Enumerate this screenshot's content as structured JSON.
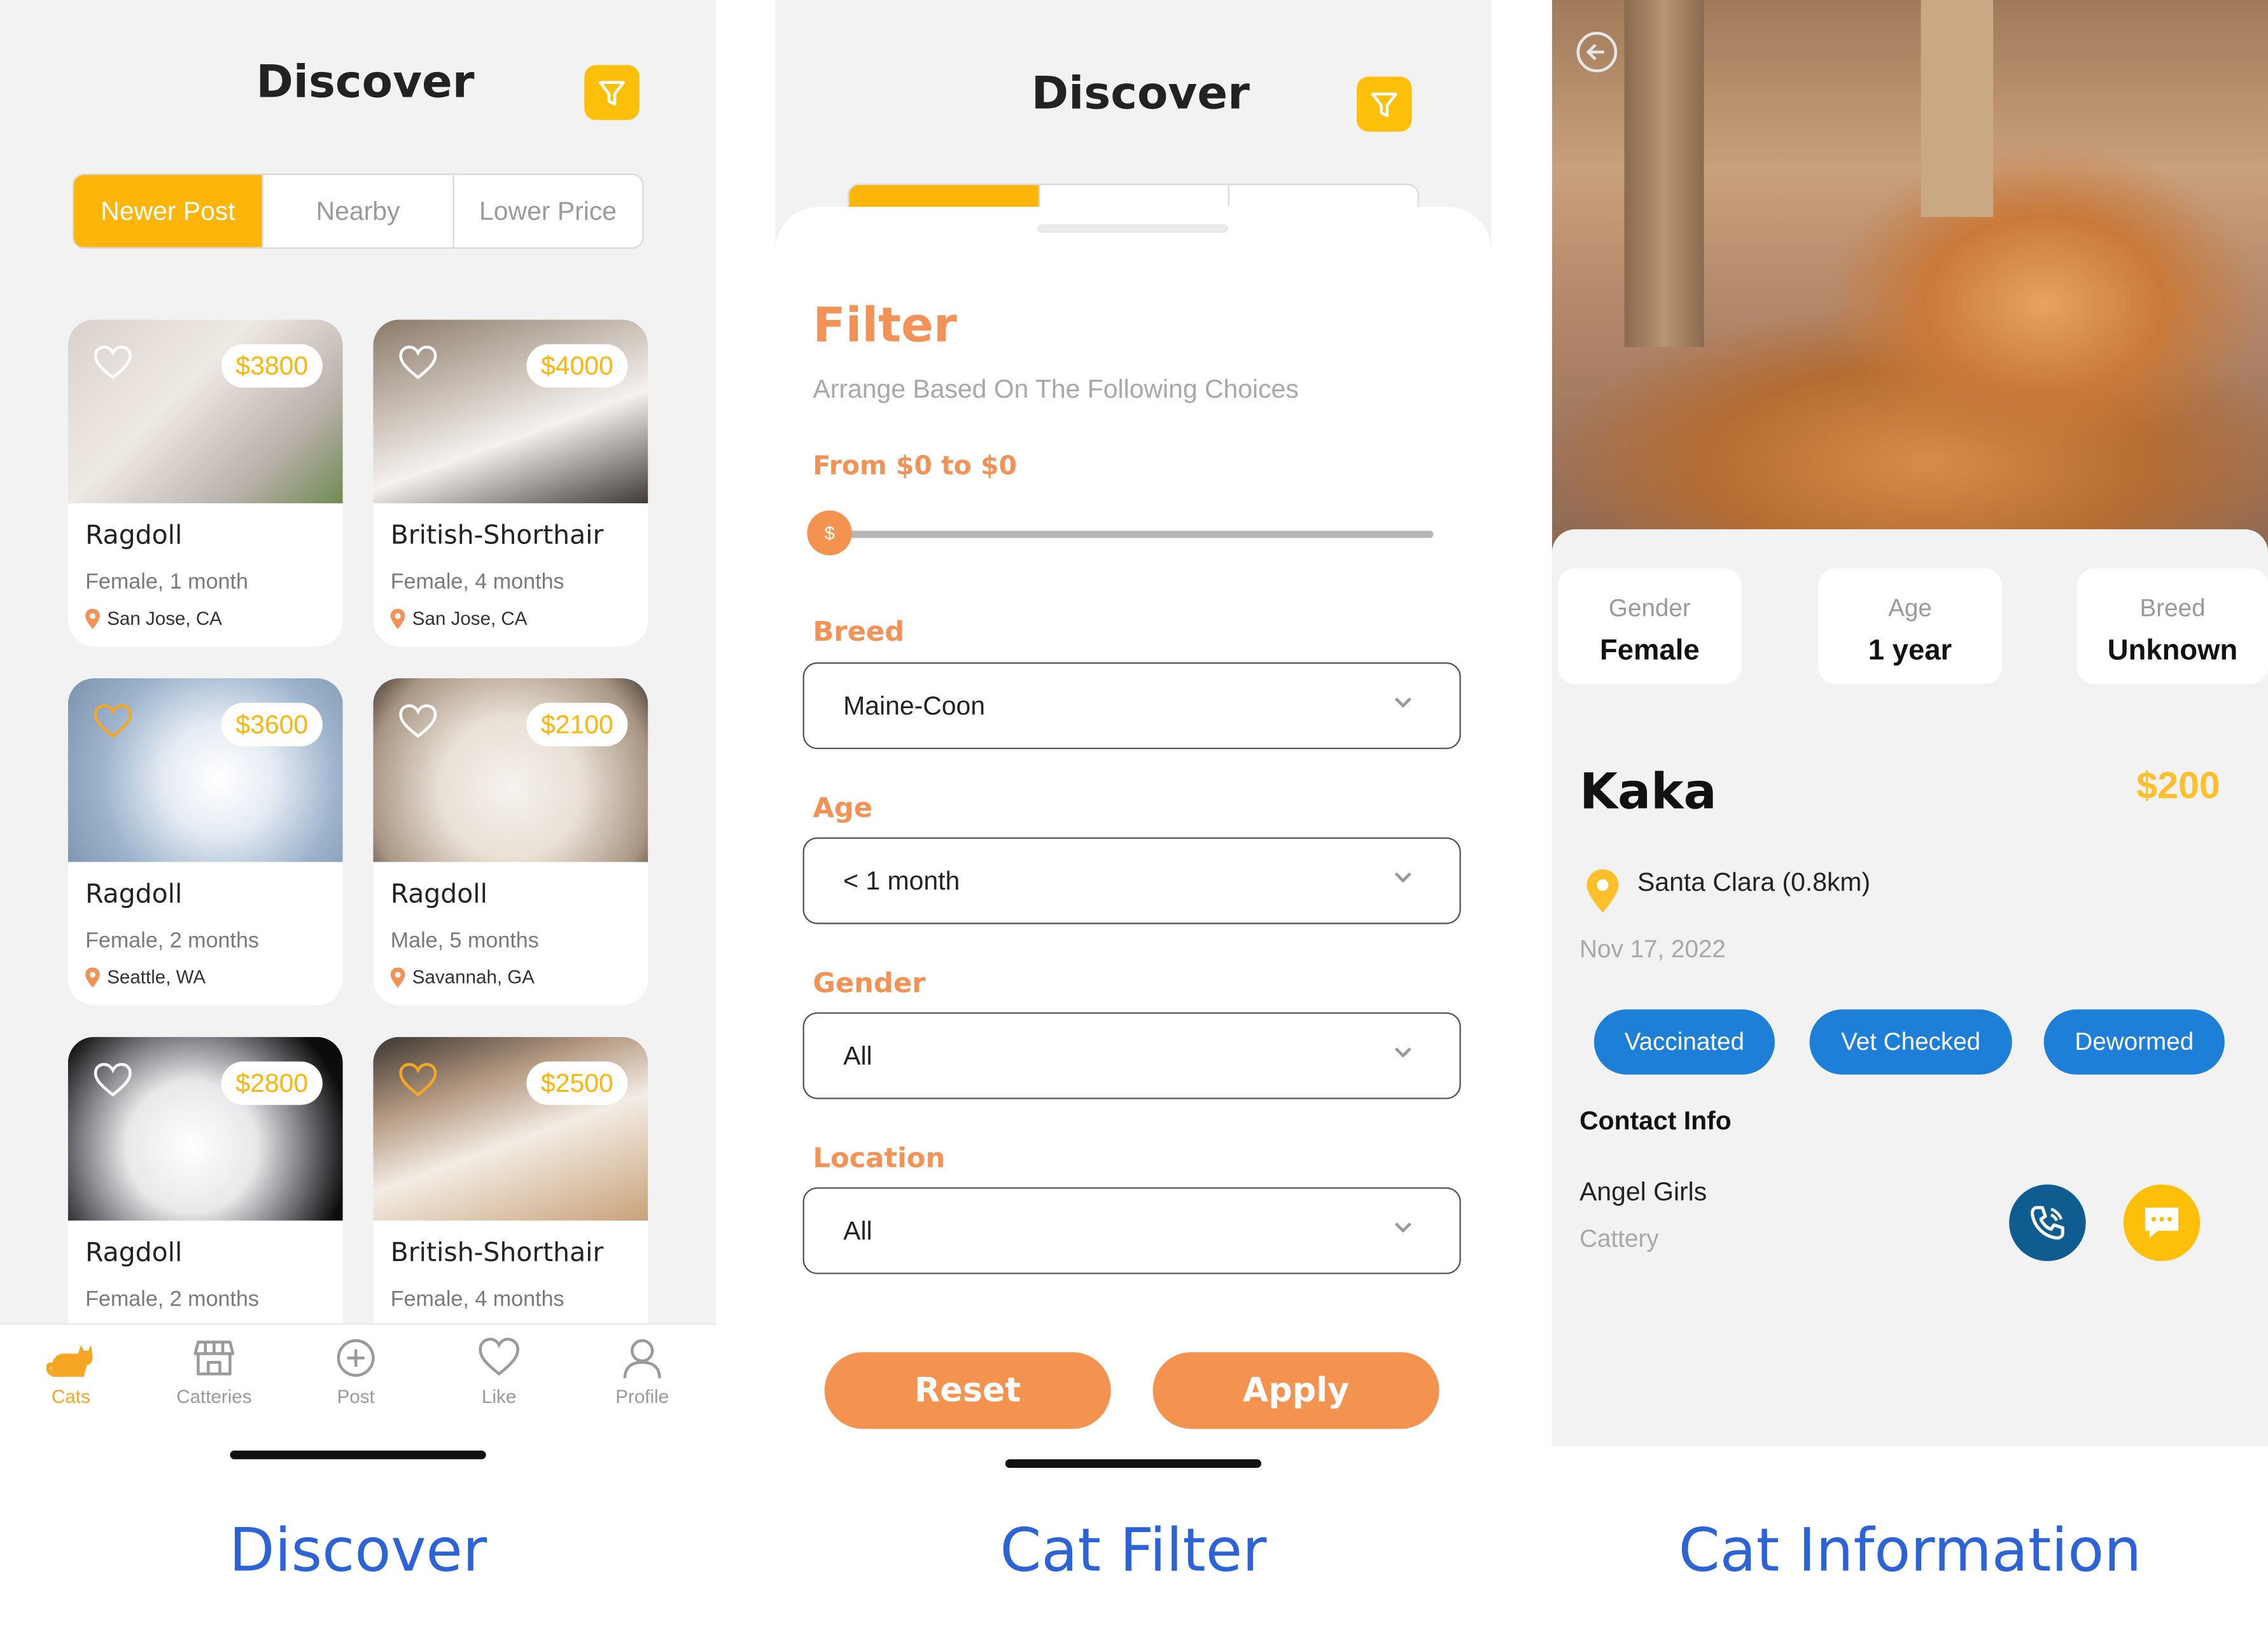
{
  "discover": {
    "title": "Discover",
    "tabs": [
      "Newer Post",
      "Nearby",
      "Lower Price"
    ],
    "cards": [
      {
        "price": "$3800",
        "breed": "Ragdoll",
        "meta": "Female, 1 month",
        "location": "San Jose, CA",
        "liked": false
      },
      {
        "price": "$4000",
        "breed": "British-Shorthair",
        "meta": "Female, 4 months",
        "location": "San Jose, CA",
        "liked": false
      },
      {
        "price": "$3600",
        "breed": "Ragdoll",
        "meta": "Female, 2 months",
        "location": "Seattle, WA",
        "liked": true
      },
      {
        "price": "$2100",
        "breed": "Ragdoll",
        "meta": "Male, 5 months",
        "location": "Savannah, GA",
        "liked": false
      },
      {
        "price": "$2800",
        "breed": "Ragdoll",
        "meta": "Female, 2 months",
        "location": "",
        "liked": false
      },
      {
        "price": "$2500",
        "breed": "British-Shorthair",
        "meta": "Female, 4 months",
        "location": "",
        "liked": true
      }
    ],
    "nav": [
      {
        "label": "Cats",
        "icon": "cat-icon",
        "active": true
      },
      {
        "label": "Catteries",
        "icon": "store-icon",
        "active": false
      },
      {
        "label": "Post",
        "icon": "plus-circle-icon",
        "active": false
      },
      {
        "label": "Like",
        "icon": "heart-icon",
        "active": false
      },
      {
        "label": "Profile",
        "icon": "user-icon",
        "active": false
      }
    ],
    "caption": "Discover"
  },
  "filter": {
    "title": "Discover",
    "sheet_title": "Filter",
    "subtitle": "Arrange Based On The Following Choices",
    "price_range": "From $0 to $0",
    "slider_value": 0,
    "slider_symbol": "$",
    "breed_label": "Breed",
    "breed_value": "Maine-Coon",
    "age_label": "Age",
    "age_value": "< 1 month",
    "gender_label": "Gender",
    "gender_value": "All",
    "location_label": "Location",
    "location_value": "All",
    "reset_label": "Reset",
    "apply_label": "Apply",
    "caption": "Cat Filter"
  },
  "info": {
    "gender_key": "Gender",
    "gender_value": "Female",
    "age_key": "Age",
    "age_value": "1 year",
    "breed_key": "Breed",
    "breed_value": "Unknown",
    "name": "Kaka",
    "price": "$200",
    "location": "Santa Clara (0.8km)",
    "date": "Nov 17, 2022",
    "tags": [
      "Vaccinated",
      "Vet Checked",
      "Dewormed"
    ],
    "contact_heading": "Contact Info",
    "contact_name": "Angel Girls",
    "contact_type": "Cattery",
    "caption": "Cat Information"
  },
  "colors": {
    "accent": "#fdb50a",
    "orange": "#f4934f",
    "blue": "#1e7fd8",
    "navy": "#0f5c91",
    "caption": "#2c63d6"
  }
}
